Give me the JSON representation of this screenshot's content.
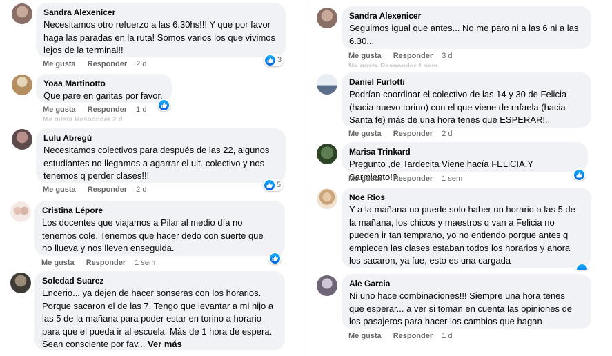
{
  "actions": {
    "like": "Me gusta",
    "reply": "Responder"
  },
  "colors": {
    "bubble": "#f0f2f5",
    "meta": "#65676b",
    "like_blue": "#0866ff"
  },
  "left": [
    {
      "author": "Sandra Alexenicer",
      "lines": [
        "Necesitamos otro refuerzo a las 6.30hs!!! Y que por favor",
        "haga las paradas en la ruta! Somos varios los que vivimos",
        "lejos de la terminal!!"
      ],
      "time": "2 d",
      "reactions": "3"
    },
    {
      "author": "Yoaa Martinotto",
      "lines": [
        "Que pare en garitas por favor."
      ],
      "time": "1 d",
      "reactions": ""
    },
    {
      "author": "Lulu Abregú",
      "lines": [
        "Necesitamos colectivos para después de las 22, algunos",
        "estudiantes no llegamos a agarrar el ult. colectivo y nos",
        "tenemos q perder clases!!!"
      ],
      "time": "2 d",
      "reactions": "5"
    },
    {
      "author": "Cristina Lépore",
      "lines": [
        "Los docentes que viajamos a Pilar al medio día no",
        "tenemos cole. Tenemos que hacer dedo con suerte que",
        "no llueva y nos lleven enseguida."
      ],
      "time": "1 sem",
      "reactions": ""
    },
    {
      "author": "Soledad Suarez",
      "lines": [
        "Encerio... ya dejen de hacer sonseras con los horarios.",
        "Porque sacaron el de las 7. Tengo que levantar a mi hijo a",
        "las 5 de la mañana para poder estar en torino a horario",
        "para que el pueda ir al escuela. Más de 1 hora de espera.",
        "Sean consciente por fav..."
      ],
      "more": "Ver más"
    }
  ],
  "right": [
    {
      "author": "Sandra Alexenicer",
      "lines": [
        "Seguimos igual que antes... No me paro ni a las 6 ni a las",
        "6.30..."
      ],
      "time": "3 d"
    },
    {
      "author": "Daniel Furlotti",
      "lines": [
        "Podrían coordinar el colectivo de las 14 y 30 de Felicia",
        "(hacia nuevo torino) con el que viene de rafaela (hacia",
        "Santa fe) más de una hora tenes que ESPERAR!.."
      ],
      "time": "2 d"
    },
    {
      "author": "Marisa Trinkard",
      "lines": [
        "Pregunto ,de Tardecita Viene hacía FELiCIA,Y Sarmiento!?"
      ],
      "time": "1 sem",
      "reactions": ""
    },
    {
      "author": "Noe Rios",
      "lines": [
        "Y a la mañana no puede solo haber un horario a las 5 de",
        "la mañana, los chicos y maestros q van a Felicia no",
        "pueden ir tan temprano, yo no entiendo porque antes q",
        "empiecen las clases estaban todos los horarios y ahora",
        "los sacaron, ya fue, esto es una cargada"
      ],
      "time": ""
    },
    {
      "author": "Ale Garcia",
      "lines": [
        "Ni uno hace combinaciones!!! Siempre una hora tenes",
        "que esperar... a ver si toman en cuenta las opiniones de",
        "los pasajeros para hacer los cambios que hagan"
      ],
      "time": "1 d"
    }
  ],
  "ghosts": {
    "a": "Me gusta   Responder   2 d",
    "b": "Me gusta   Responder   1 sem"
  }
}
